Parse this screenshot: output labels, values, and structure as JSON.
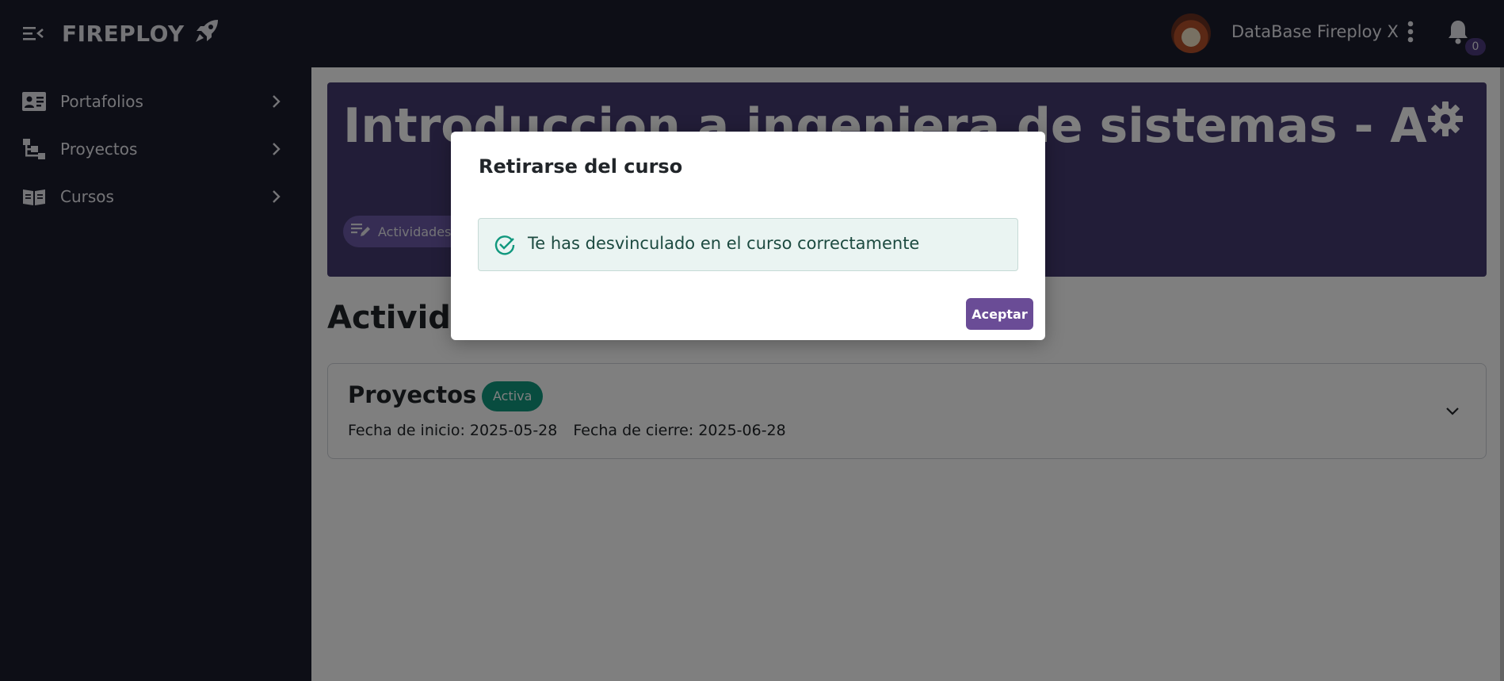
{
  "app": {
    "brand_name": "FIREPLOY",
    "brand_icon": "rocket-icon"
  },
  "header": {
    "menu_icon": "menu-collapse-icon",
    "user_name": "DataBase Fireploy X",
    "kebab_icon": "more-vertical-icon",
    "notifications_icon": "bell-icon",
    "notifications_count": "0"
  },
  "sidebar": {
    "items": [
      {
        "label": "Portafolios",
        "icon": "id-card-icon"
      },
      {
        "label": "Proyectos",
        "icon": "hierarchy-icon"
      },
      {
        "label": "Cursos",
        "icon": "book-icon"
      }
    ]
  },
  "course": {
    "title": "Introduccion a ingeniera de sistemas - A",
    "settings_icon": "gear-icon",
    "activities_chip_label": "Actividades:"
  },
  "activities": {
    "section_title": "Actividades",
    "cards": [
      {
        "title": "Proyectos",
        "status": "Activa",
        "start_date": "Fecha de inicio: 2025-05-28",
        "end_date": "Fecha de cierre: 2025-06-28"
      }
    ]
  },
  "modal": {
    "title": "Retirarse del curso",
    "message": "Te has desvinculado en el curso correctamente",
    "accept_label": "Aceptar"
  },
  "colors": {
    "dark_bg": "#1b1c2c",
    "hero_bg": "#453b70",
    "accent_purple": "#6a4c96",
    "status_green": "#11987e",
    "alert_bg": "#eaf4f2"
  }
}
